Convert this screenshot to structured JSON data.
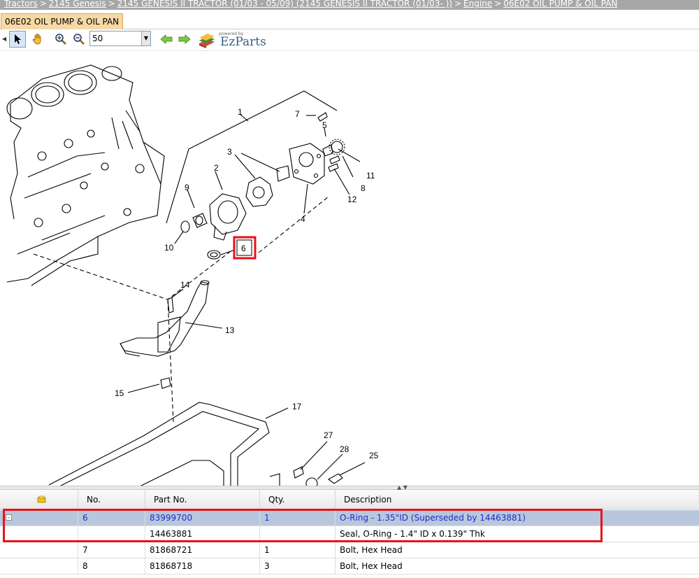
{
  "breadcrumb": {
    "items": [
      "Tractors",
      "2145 Genesis",
      "2145 GENESIS II TRACTOR (01/03 - 05/09) (2145 GENESIS II TRACTOR (01/03- ))",
      "Engine",
      "06E02 OIL PUMP & OIL PAN"
    ],
    "separator": ">"
  },
  "tab": {
    "label": "06E02 OIL PUMP & OIL PAN"
  },
  "toolbar": {
    "zoom_value": "50",
    "logo_small": "powered by",
    "logo_big": "EzParts",
    "icons": [
      "pointer-icon",
      "pan-hand-icon",
      "zoom-in-icon",
      "zoom-out-icon",
      "arrow-back-icon",
      "arrow-forward-icon",
      "books-icon"
    ]
  },
  "diagram": {
    "callouts": [
      "1",
      "2",
      "3",
      "4",
      "5",
      "6",
      "7",
      "8",
      "9",
      "10",
      "11",
      "12",
      "13",
      "14",
      "15",
      "17",
      "25",
      "27",
      "28"
    ],
    "selected_callout": "6"
  },
  "table": {
    "headers": [
      "No.",
      "Part No.",
      "Qty.",
      "Description"
    ],
    "rows": [
      {
        "no": "6",
        "part": "83999700",
        "qty": "1",
        "desc": "O-Ring - 1.35\"ID (Superseded by 14463881)"
      },
      {
        "no": "",
        "part": "14463881",
        "qty": "",
        "desc": "Seal, O-Ring - 1.4\" ID x 0.139\" Thk"
      },
      {
        "no": "7",
        "part": "81868721",
        "qty": "1",
        "desc": "Bolt, Hex Head"
      },
      {
        "no": "8",
        "part": "81868718",
        "qty": "3",
        "desc": "Bolt, Hex Head"
      }
    ]
  },
  "colors": {
    "highlight": "#e8101a",
    "selected_row": "#b9c7dc",
    "tab": "#f6d9a5",
    "breadcrumb_bg": "#a7a7a7"
  }
}
